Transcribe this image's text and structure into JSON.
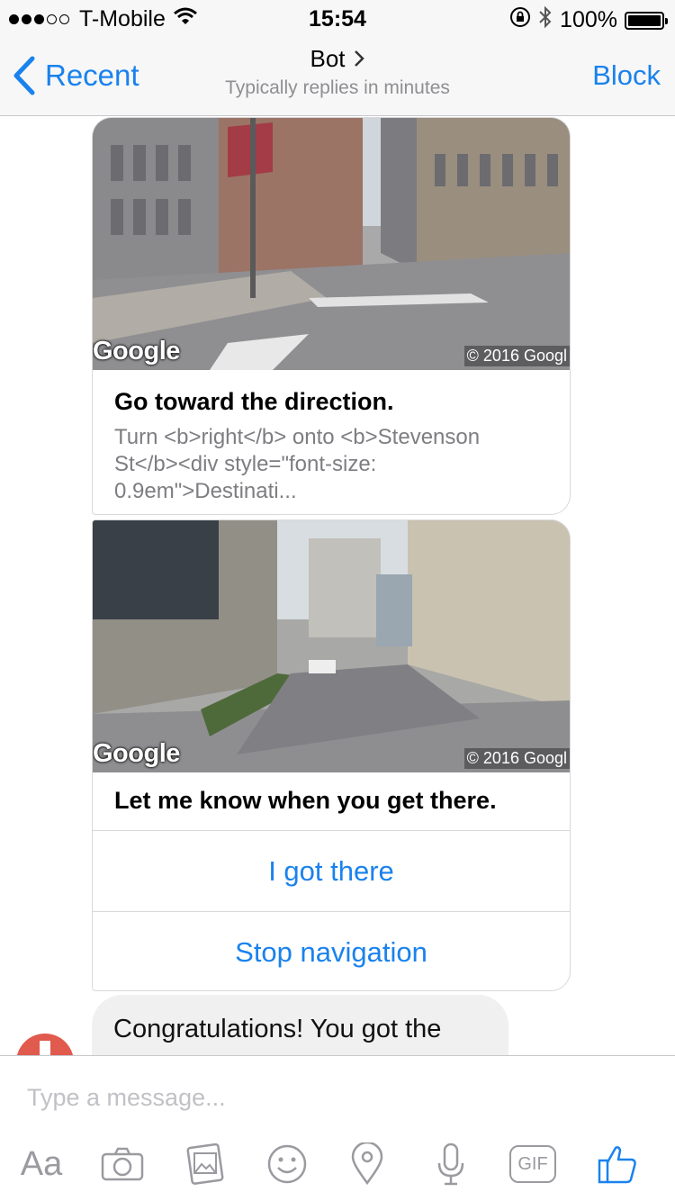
{
  "status_bar": {
    "carrier": "T-Mobile",
    "time": "15:54",
    "battery": "100%",
    "signal_bars_filled": 3,
    "signal_bars_total": 5
  },
  "header": {
    "back_label": "Recent",
    "title": "Bot",
    "subtitle": "Typically replies in minutes",
    "block_label": "Block"
  },
  "messages": {
    "card1": {
      "image_logo": "Google",
      "image_copyright": "© 2016 Googl",
      "title": "Go toward the direction.",
      "subtitle": "Turn <b>right</b> onto <b>Stevenson St</b><div style=\"font-size: 0.9em\">Destinati..."
    },
    "card2": {
      "image_logo": "Google",
      "image_copyright": "© 2016 Googl",
      "title": "Let me know when you get there.",
      "buttons": [
        "I got there",
        "Stop navigation"
      ]
    },
    "bubble_text": "Congratulations! You got the destination."
  },
  "composer": {
    "placeholder": "Type a message...",
    "aa_label": "Aa",
    "gif_label": "GIF",
    "icons": [
      "camera-icon",
      "photo-icon",
      "emoji-icon",
      "location-icon",
      "microphone-icon",
      "gif-icon",
      "thumbs-up-icon"
    ]
  },
  "colors": {
    "accent": "#1a82ed",
    "bar_background": "#f7f7f7",
    "bubble_background": "#f1f0f0"
  }
}
